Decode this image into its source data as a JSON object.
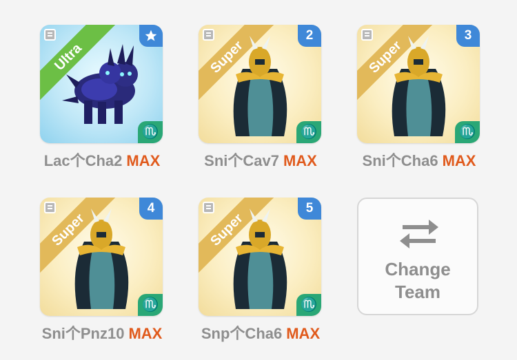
{
  "monsters": [
    {
      "rarity": "Ultra",
      "slot_icon": "star-icon",
      "zodiac": "♏",
      "name": "Lac个Cha2",
      "level": "MAX",
      "theme": "ultra"
    },
    {
      "rarity": "Super",
      "slot": "2",
      "zodiac": "♏",
      "name": "Sni个Cav7",
      "level": "MAX",
      "theme": "super"
    },
    {
      "rarity": "Super",
      "slot": "3",
      "zodiac": "♏",
      "name": "Sni个Cha6",
      "level": "MAX",
      "theme": "super"
    },
    {
      "rarity": "Super",
      "slot": "4",
      "zodiac": "♏",
      "name": "Sni个Pnz10",
      "level": "MAX",
      "theme": "super"
    },
    {
      "rarity": "Super",
      "slot": "5",
      "zodiac": "♏",
      "name": "Snp个Cha6",
      "level": "MAX",
      "theme": "super"
    }
  ],
  "change_team": {
    "line1": "Change",
    "line2": "Team",
    "icon": "swap-arrows-icon"
  },
  "colors": {
    "ultra_ribbon": "#6cbf45",
    "super_ribbon": "#e2b95a",
    "slot_badge": "#3f88d8",
    "zodiac_badge": "#2aa776",
    "max": "#e05a1c"
  }
}
